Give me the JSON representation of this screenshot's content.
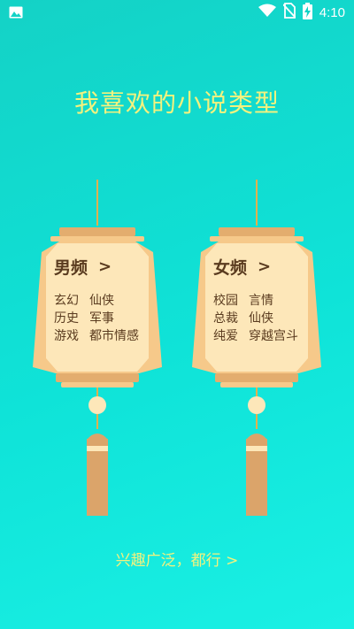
{
  "status_bar": {
    "time": "4:10",
    "icons": [
      "image-icon",
      "wifi-icon",
      "no-sim-icon",
      "battery-charging-icon"
    ]
  },
  "title": "我喜欢的小说类型",
  "male": {
    "label": "男频",
    "chevron": ">",
    "genres": [
      [
        "玄幻",
        "仙侠"
      ],
      [
        "历史",
        "军事"
      ],
      [
        "游戏",
        "都市情感"
      ]
    ]
  },
  "female": {
    "label": "女频",
    "chevron": ">",
    "genres": [
      [
        "校园",
        "言情"
      ],
      [
        "总裁",
        "仙侠"
      ],
      [
        "纯爱",
        "穿越宫斗"
      ]
    ]
  },
  "bottom_link": "兴趣广泛，都行 >",
  "colors": {
    "bg": "#14d2c6",
    "title": "#f3f27e",
    "lantern_body": "#fde7b9",
    "lantern_side": "#f6c98a",
    "lantern_band": "#e3ad6e",
    "tassel": "#dba46a",
    "text_brown": "#5a3b1f"
  }
}
